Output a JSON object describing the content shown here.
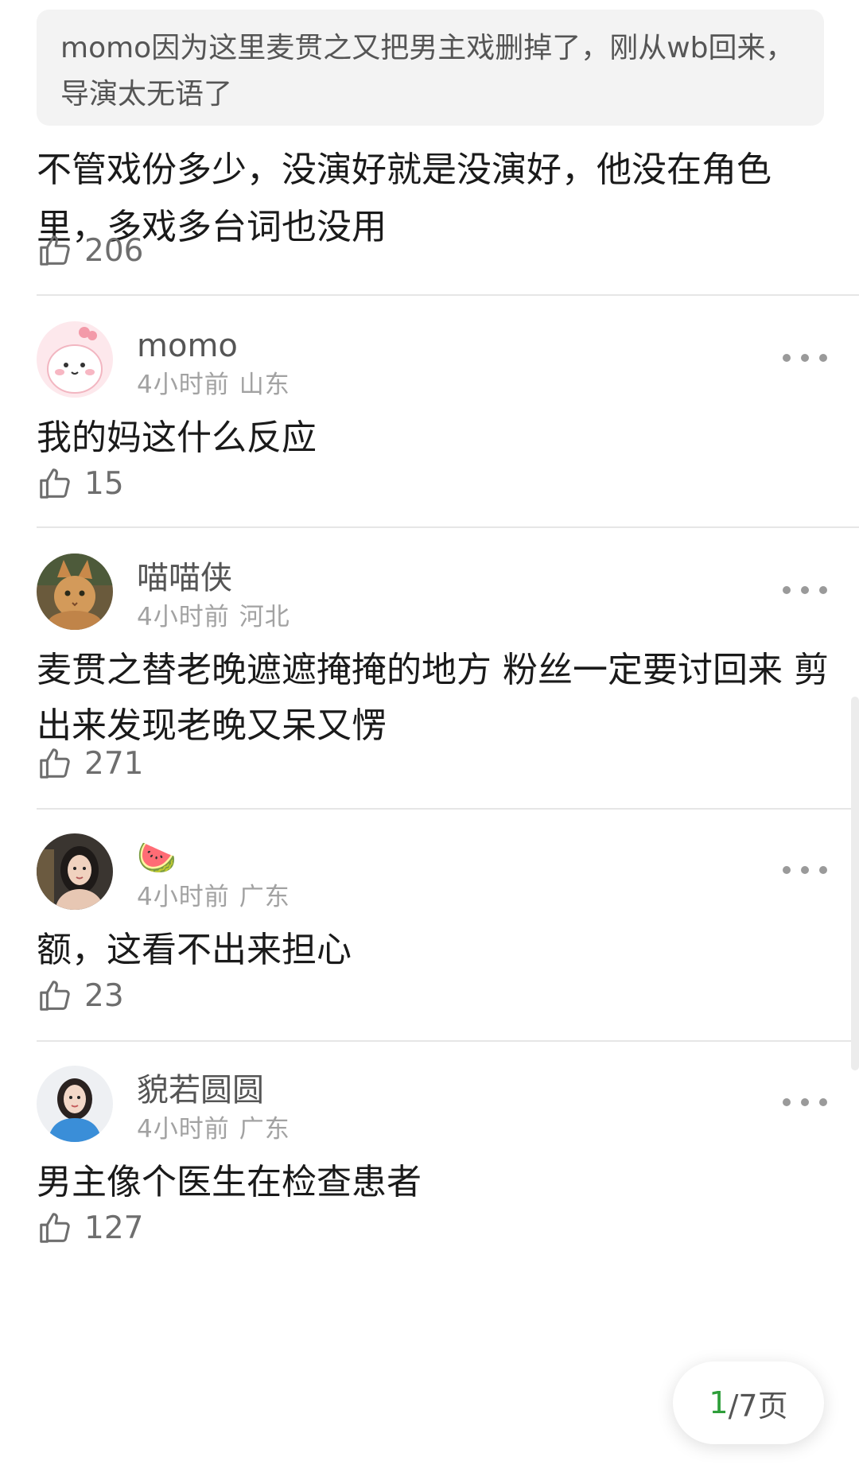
{
  "quoted_comment": "momo因为这里麦贯之又把男主戏删掉了，刚从wb回来，导演太无语了",
  "reply": {
    "text": "不管戏份多少，没演好就是没演好，他没在角色里，多戏多台词也没用",
    "likes": "206"
  },
  "comments": [
    {
      "username": "momo",
      "time": "4小时前",
      "location": "山东",
      "text": "我的妈这什么反应",
      "likes": "15",
      "avatar_icon": "pink-cartoon-avatar-icon"
    },
    {
      "username": "喵喵侠",
      "time": "4小时前",
      "location": "河北",
      "text": "麦贯之替老晚遮遮掩掩的地方 粉丝一定要讨回来 剪出来发现老晚又呆又愣",
      "likes": "271",
      "avatar_icon": "cat-photo-avatar-icon"
    },
    {
      "username": "🍉",
      "time": "4小时前",
      "location": "广东",
      "text": "额，这看不出来担心",
      "likes": "23",
      "avatar_icon": "woman-photo-avatar-icon"
    },
    {
      "username": "貌若圆圆",
      "time": "4小时前",
      "location": "广东",
      "text": "男主像个医生在检查患者",
      "likes": "127",
      "avatar_icon": "woman-blue-shirt-avatar-icon"
    }
  ],
  "pagination": {
    "current": "1",
    "total": "/7页"
  },
  "icons": {
    "like": "thumbs-up-icon",
    "more": "more-options-icon"
  },
  "colors": {
    "accent_green": "#2e9e3a",
    "text": "#1a1a1a",
    "meta_gray": "#a2a2a2",
    "quote_bg": "#f3f3f3"
  }
}
